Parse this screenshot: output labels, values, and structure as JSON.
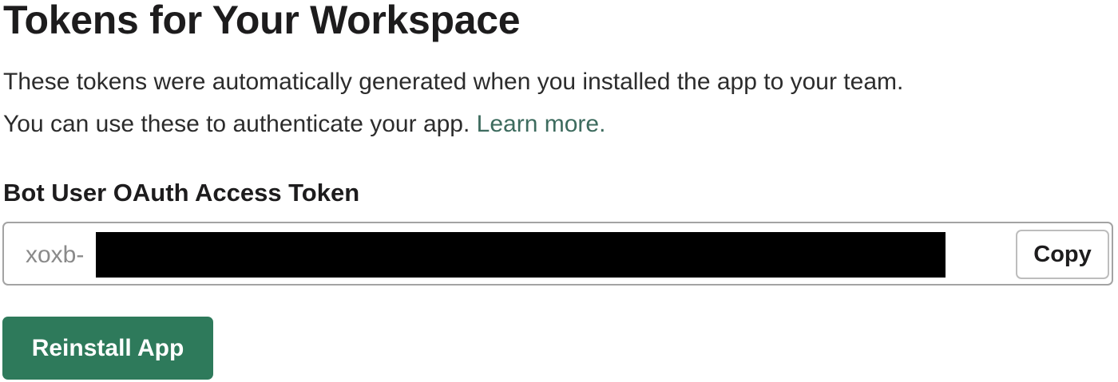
{
  "page": {
    "title": "Tokens for Your Workspace"
  },
  "description": {
    "line1": "These tokens were automatically generated when you installed the app to your team.",
    "line2": "You can use these to authenticate your app.",
    "learn_more_label": "Learn more."
  },
  "token": {
    "label": "Bot User OAuth Access Token",
    "value_prefix": "xoxb-",
    "value_redacted": true,
    "copy_label": "Copy"
  },
  "actions": {
    "reinstall_label": "Reinstall App"
  },
  "colors": {
    "primary_button": "#2e7a5b",
    "link": "#3d6b5e",
    "field_border": "#a3a3a3",
    "redaction": "#000000"
  }
}
